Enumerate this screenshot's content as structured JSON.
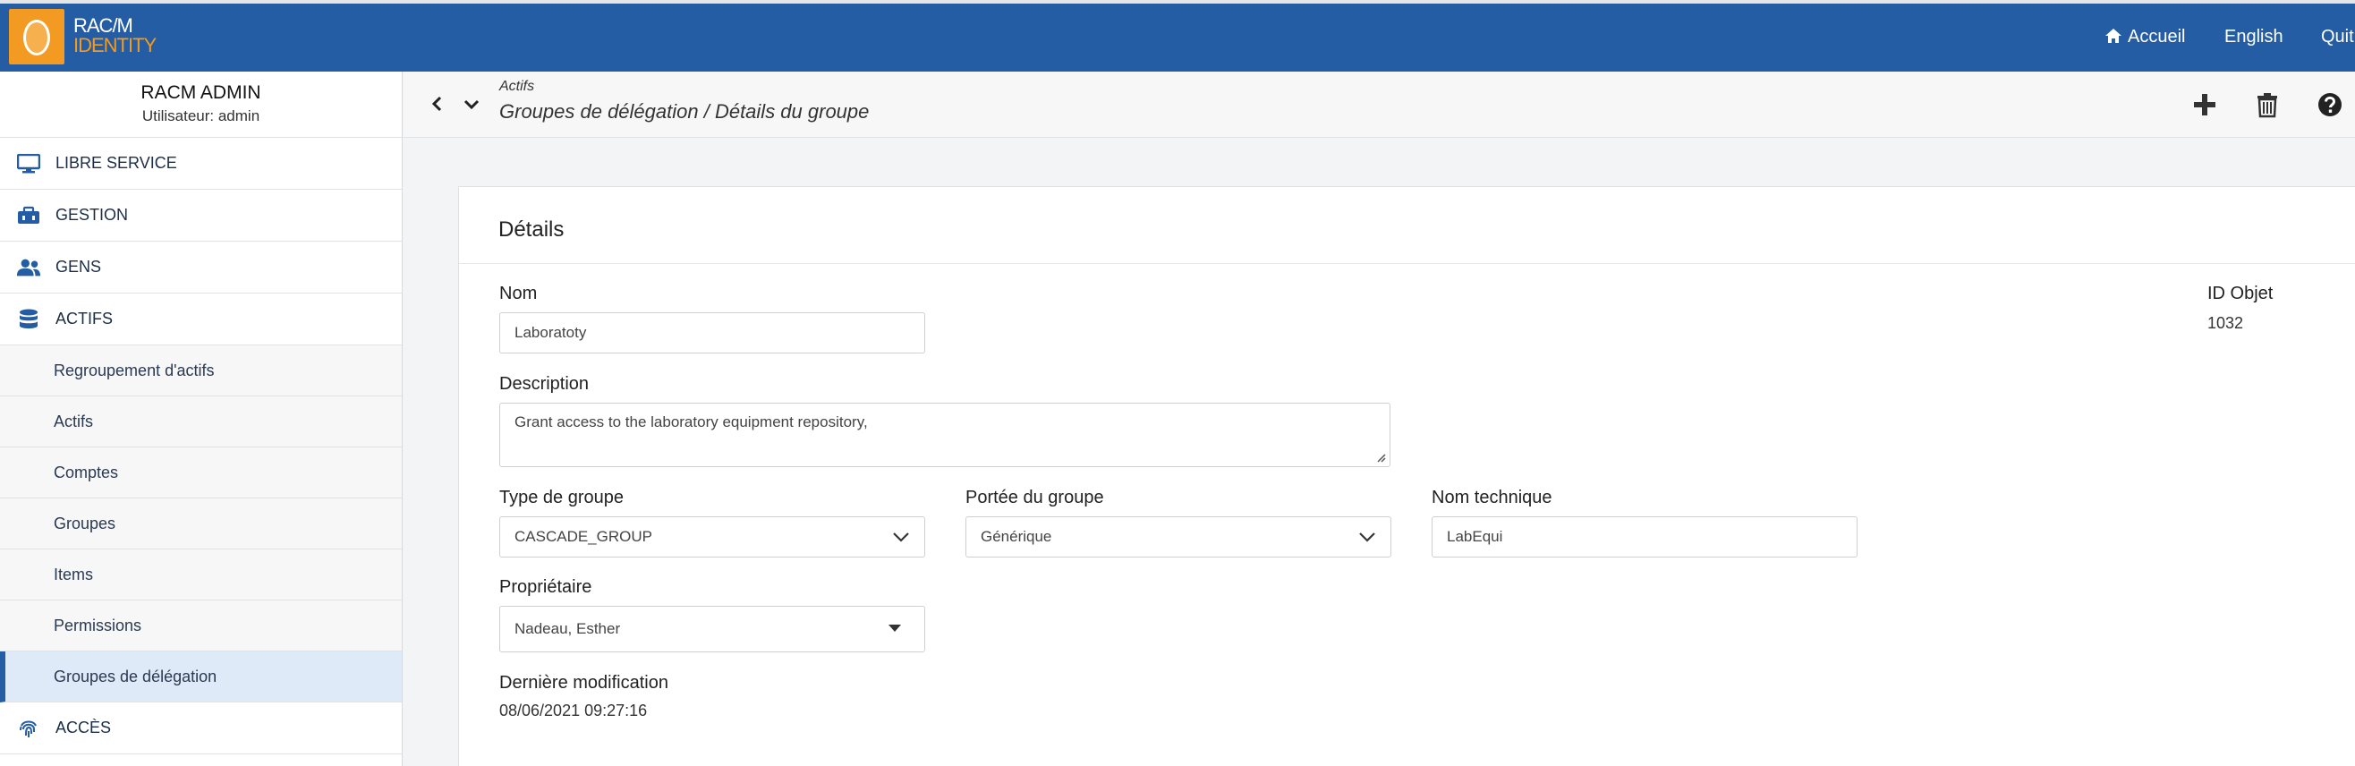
{
  "app": {
    "logo_line1": "RAC/M",
    "logo_line2": "IDENTITY"
  },
  "topnav": {
    "home": "Accueil",
    "language": "English",
    "quit": "Quit"
  },
  "user": {
    "name": "RACM ADMIN",
    "subtitle": "Utilisateur: admin"
  },
  "sidebar": {
    "libre_service": "LIBRE SERVICE",
    "gestion": "GESTION",
    "gens": "GENS",
    "actifs": "ACTIFS",
    "sub_items": [
      "Regroupement d'actifs",
      "Actifs",
      "Comptes",
      "Groupes",
      "Items",
      "Permissions",
      "Groupes de délégation"
    ],
    "acces": "ACCÈS"
  },
  "breadcrumb": {
    "parent": "Actifs",
    "current": "Groupes de délégation / Détails du groupe"
  },
  "card": {
    "title": "Détails",
    "nom_label": "Nom",
    "nom_value": "Laboratoty",
    "id_label": "ID Objet",
    "id_value": "1032",
    "description_label": "Description",
    "description_value": "Grant access to the laboratory equipment repository,",
    "type_label": "Type de groupe",
    "type_value": "CASCADE_GROUP",
    "portee_label": "Portée du groupe",
    "portee_value": "Générique",
    "nom_tech_label": "Nom technique",
    "nom_tech_value": "LabEqui",
    "proprietaire_label": "Propriétaire",
    "proprietaire_value": "Nadeau, Esther",
    "derniere_label": "Dernière modification",
    "derniere_value": "08/06/2021 09:27:16"
  },
  "colors": {
    "brand_blue": "#245da3",
    "brand_orange": "#f29a21"
  }
}
